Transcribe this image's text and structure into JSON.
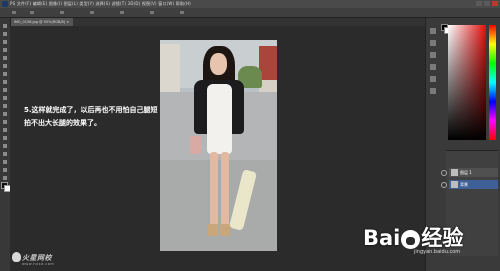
{
  "app": {
    "menu_text": "PS  文件(F)  编辑(E)  图像(I)  图层(L)  类型(Y)  选择(S)  滤镜(T)  3D(D)  视图(V)  窗口(W)  帮助(H)",
    "doc_tab": "IMG_0156.jpg @ 50%(RGB/8)  ×"
  },
  "canvas": {
    "caption": "5.这样就完成了，以后再也不用怕自己腿短拍不出大长腿的效果了。"
  },
  "layers": {
    "items": [
      {
        "name": "图层 1"
      },
      {
        "name": "背景"
      }
    ]
  },
  "watermarks": {
    "left_brand": "火星网校",
    "left_url": "www.hxsd.com",
    "baidu_logo": "Bai经验",
    "baidu_url": "jingyan.baidu.com"
  },
  "colors": {
    "bg": "#2b2b2b",
    "panel": "#3a3a3a",
    "accent_selected": "#3e6096"
  }
}
